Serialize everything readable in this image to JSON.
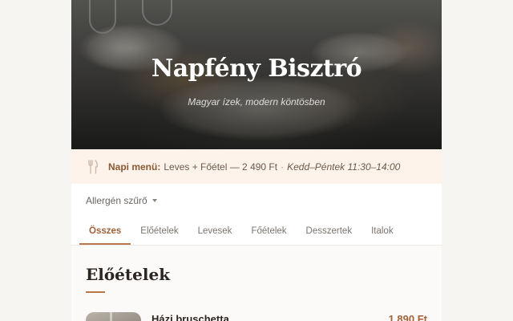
{
  "hero": {
    "title": "Napfény Bisztró",
    "subtitle": "Magyar ízek, modern köntösben"
  },
  "daily_menu": {
    "icon": "fork-knife-icon",
    "label": "Napi menü:",
    "text": "Leves + Főétel — 2 490 Ft",
    "separator": "·",
    "time": "Kedd–Péntek 11:30–14:00"
  },
  "filter": {
    "label": "Allergén szűrő",
    "icon": "chevron-down-icon"
  },
  "tabs": [
    {
      "label": "Összes",
      "active": true
    },
    {
      "label": "Előételek",
      "active": false
    },
    {
      "label": "Levesek",
      "active": false
    },
    {
      "label": "Főételek",
      "active": false
    },
    {
      "label": "Desszertek",
      "active": false
    },
    {
      "label": "Italok",
      "active": false
    }
  ],
  "section": {
    "title": "Előételek"
  },
  "dishes": [
    {
      "name": "Házi bruschetta",
      "price": "1 890 Ft"
    }
  ],
  "colors": {
    "accent": "#b8784c",
    "accent_text": "#a0623a",
    "banner_bg": "#fdf3ea"
  }
}
